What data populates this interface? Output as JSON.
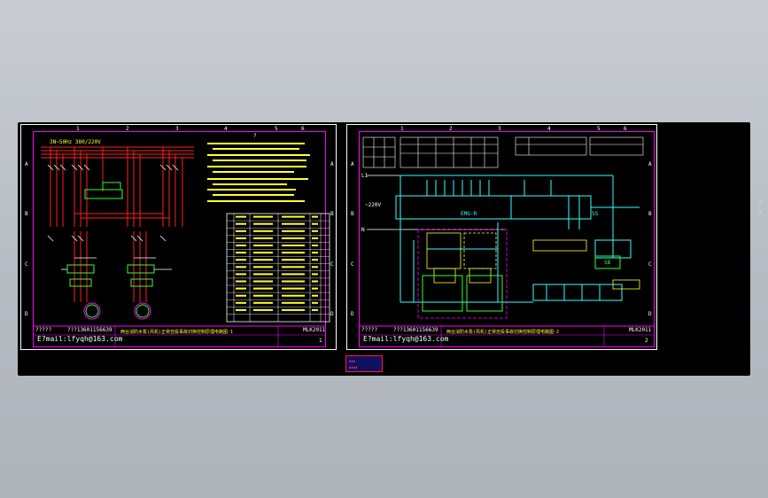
{
  "sheet_left": {
    "supply_label": "3N~50Hz 380/220V",
    "question_mark": "?",
    "title_block": {
      "phone": "???13601156639",
      "email": "E?mail:lfyqh@163.com",
      "title": "两台消防水泵(风机)正常自投事故切换控制原理电路图-1",
      "code": "MLK2011",
      "extra_left": "?????",
      "page": "1"
    }
  },
  "sheet_right": {
    "title_block": {
      "phone": "???13601156639",
      "email": "E?mail:lfyqh@163.com",
      "title": "两台消防水泵(风机)正常自投事故切换控制原理电路图-2",
      "code": "MLK2011",
      "extra_left": "?????",
      "page": "2"
    },
    "label_emg": "EMG-R",
    "label_ss": "SS",
    "label_sb": "SB",
    "label_220": "~220V",
    "label_l1": "L1",
    "label_n": "N"
  },
  "rulers": {
    "cols": [
      "1",
      "2",
      "3",
      "4",
      "5",
      "6"
    ],
    "rows": [
      "A",
      "B",
      "C",
      "D"
    ]
  },
  "side_nav": [
    "?",
    "?"
  ],
  "colors": {
    "background": "#b9bec5",
    "canvas": "#000000",
    "frame": "#ff00ff",
    "text_yellow": "#ffff33",
    "line_red": "#ff2020",
    "line_cyan": "#33ffff",
    "line_green": "#33ff33"
  }
}
